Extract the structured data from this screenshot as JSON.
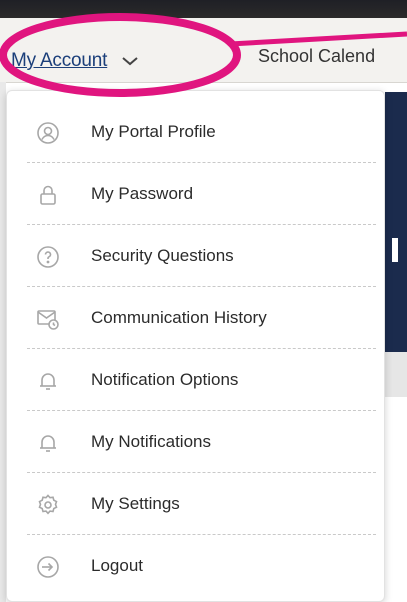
{
  "nav": {
    "account_label": "My Account",
    "calendar_label": "School Calend"
  },
  "menu": {
    "items": [
      {
        "label": "My Portal Profile",
        "icon": "profile-icon"
      },
      {
        "label": "My Password",
        "icon": "lock-icon"
      },
      {
        "label": "Security Questions",
        "icon": "question-icon"
      },
      {
        "label": "Communication History",
        "icon": "mail-history-icon"
      },
      {
        "label": "Notification Options",
        "icon": "bell-icon"
      },
      {
        "label": "My Notifications",
        "icon": "bell-icon"
      },
      {
        "label": "My Settings",
        "icon": "gear-icon"
      },
      {
        "label": "Logout",
        "icon": "logout-icon"
      }
    ]
  },
  "colors": {
    "annotation": "#e0157f",
    "link": "#1b3f7a",
    "icon": "#a7a7a7"
  }
}
